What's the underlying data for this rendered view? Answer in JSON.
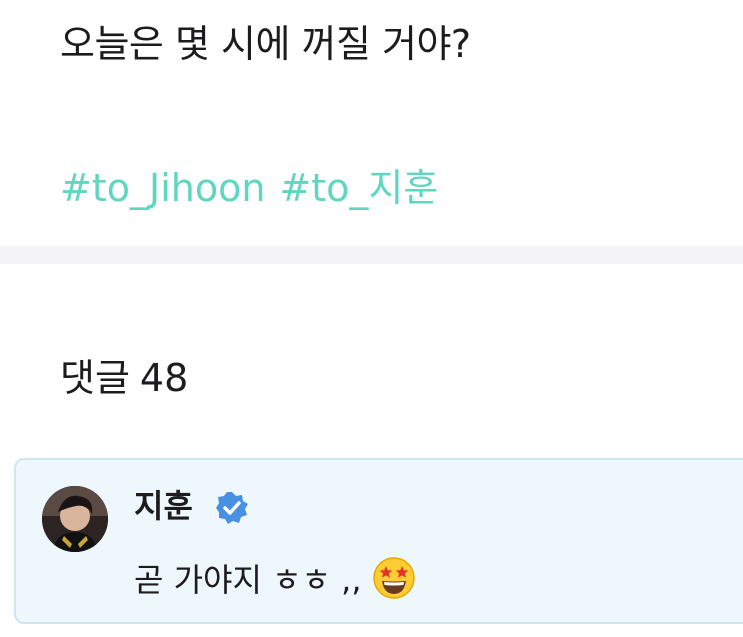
{
  "post": {
    "text": "오늘은 몇 시에 꺼질 거야?",
    "hashtags": [
      "#to_Jihoon",
      "#to_지훈"
    ]
  },
  "comments": {
    "label": "댓글",
    "count": "48",
    "items": [
      {
        "author": "지훈",
        "verified": true,
        "text": "곧 가야지 ㅎㅎ ,,",
        "emoji": "star-struck-emoji-icon"
      }
    ]
  },
  "colors": {
    "hashtag": "#5fd6c0",
    "verified": "#4a90e2",
    "comment_bg": "#eef7fc",
    "comment_border": "#cfe6f1",
    "divider": "#f4f4f7"
  }
}
